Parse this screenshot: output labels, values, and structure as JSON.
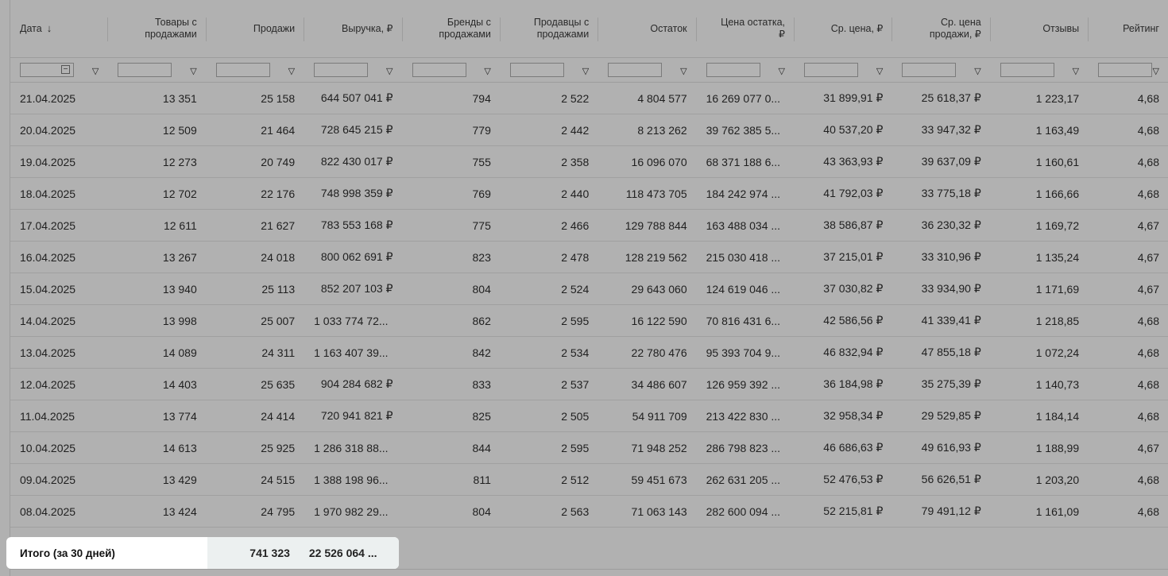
{
  "columns": [
    {
      "label": "Дата",
      "sort": "↓"
    },
    {
      "label": "Товары с\nпродажами"
    },
    {
      "label": "Продажи"
    },
    {
      "label": "Выручка, ₽"
    },
    {
      "label": "Бренды с\nпродажами"
    },
    {
      "label": "Продавцы с\nпродажами"
    },
    {
      "label": "Остаток"
    },
    {
      "label": "Цена остатка,\n₽"
    },
    {
      "label": "Ср. цена, ₽"
    },
    {
      "label": "Ср. цена\nпродажи, ₽"
    },
    {
      "label": "Отзывы"
    },
    {
      "label": "Рейтинг"
    }
  ],
  "filter_icon": "filter-funnel-icon",
  "rows": [
    [
      "21.04.2025",
      "13 351",
      "25 158",
      "644 507 041 ₽",
      "794",
      "2 522",
      "4 804 577",
      "16 269 077 0...",
      "31 899,91 ₽",
      "25 618,37 ₽",
      "1 223,17",
      "4,68"
    ],
    [
      "20.04.2025",
      "12 509",
      "21 464",
      "728 645 215 ₽",
      "779",
      "2 442",
      "8 213 262",
      "39 762 385 5...",
      "40 537,20 ₽",
      "33 947,32 ₽",
      "1 163,49",
      "4,68"
    ],
    [
      "19.04.2025",
      "12 273",
      "20 749",
      "822 430 017 ₽",
      "755",
      "2 358",
      "16 096 070",
      "68 371 188 6...",
      "43 363,93 ₽",
      "39 637,09 ₽",
      "1 160,61",
      "4,68"
    ],
    [
      "18.04.2025",
      "12 702",
      "22 176",
      "748 998 359 ₽",
      "769",
      "2 440",
      "118 473 705",
      "184 242 974 ...",
      "41 792,03 ₽",
      "33 775,18 ₽",
      "1 166,66",
      "4,68"
    ],
    [
      "17.04.2025",
      "12 611",
      "21 627",
      "783 553 168 ₽",
      "775",
      "2 466",
      "129 788 844",
      "163 488 034 ...",
      "38 586,87 ₽",
      "36 230,32 ₽",
      "1 169,72",
      "4,67"
    ],
    [
      "16.04.2025",
      "13 267",
      "24 018",
      "800 062 691 ₽",
      "823",
      "2 478",
      "128 219 562",
      "215 030 418 ...",
      "37 215,01 ₽",
      "33 310,96 ₽",
      "1 135,24",
      "4,67"
    ],
    [
      "15.04.2025",
      "13 940",
      "25 113",
      "852 207 103 ₽",
      "804",
      "2 524",
      "29 643 060",
      "124 619 046 ...",
      "37 030,82 ₽",
      "33 934,90 ₽",
      "1 171,69",
      "4,67"
    ],
    [
      "14.04.2025",
      "13 998",
      "25 007",
      "1 033 774 72...",
      "862",
      "2 595",
      "16 122 590",
      "70 816 431 6...",
      "42 586,56 ₽",
      "41 339,41 ₽",
      "1 218,85",
      "4,68"
    ],
    [
      "13.04.2025",
      "14 089",
      "24 311",
      "1 163 407 39...",
      "842",
      "2 534",
      "22 780 476",
      "95 393 704 9...",
      "46 832,94 ₽",
      "47 855,18 ₽",
      "1 072,24",
      "4,68"
    ],
    [
      "12.04.2025",
      "14 403",
      "25 635",
      "904 284 682 ₽",
      "833",
      "2 537",
      "34 486 607",
      "126 959 392 ...",
      "36 184,98 ₽",
      "35 275,39 ₽",
      "1 140,73",
      "4,68"
    ],
    [
      "11.04.2025",
      "13 774",
      "24 414",
      "720 941 821 ₽",
      "825",
      "2 505",
      "54 911 709",
      "213 422 830 ...",
      "32 958,34 ₽",
      "29 529,85 ₽",
      "1 184,14",
      "4,68"
    ],
    [
      "10.04.2025",
      "14 613",
      "25 925",
      "1 286 318 88...",
      "844",
      "2 595",
      "71 948 252",
      "286 798 823 ...",
      "46 686,63 ₽",
      "49 616,93 ₽",
      "1 188,99",
      "4,67"
    ],
    [
      "09.04.2025",
      "13 429",
      "24 515",
      "1 388 198 96...",
      "811",
      "2 512",
      "59 451 673",
      "262 631 205 ...",
      "52 476,53 ₽",
      "56 626,51 ₽",
      "1 203,20",
      "4,68"
    ],
    [
      "08.04.2025",
      "13 424",
      "24 795",
      "1 970 982 29...",
      "804",
      "2 563",
      "71 063 143",
      "282 600 094 ...",
      "52 215,81 ₽",
      "79 491,12 ₽",
      "1 161,09",
      "4,68"
    ]
  ],
  "footer": {
    "label": "Итого (за 30 дней)",
    "sales": "741 323",
    "revenue": "22 526 064 ..."
  }
}
